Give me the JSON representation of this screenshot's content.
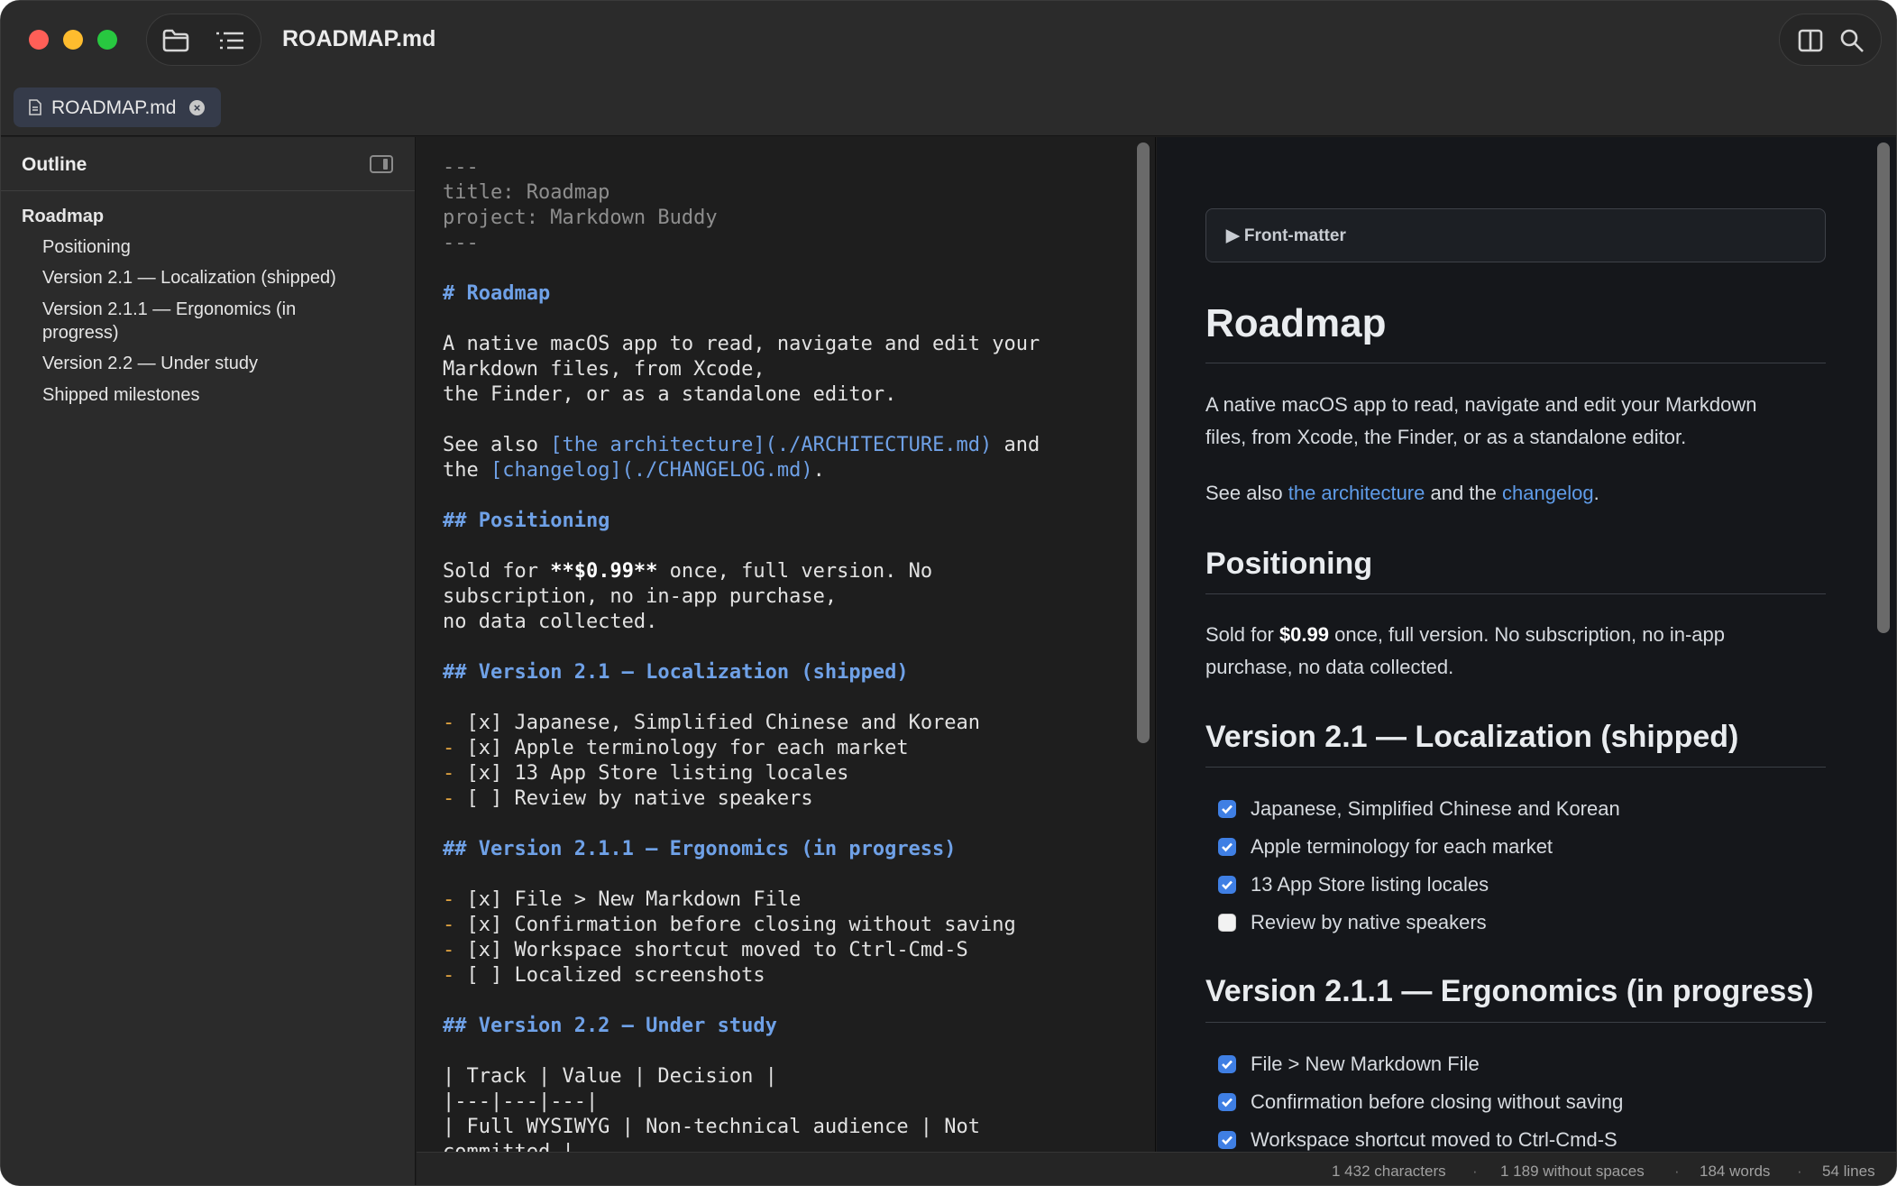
{
  "window": {
    "title": "ROADMAP.md"
  },
  "tab": {
    "label": "ROADMAP.md",
    "close": "×"
  },
  "sidebar": {
    "title": "Outline",
    "items": [
      {
        "label": "Roadmap"
      },
      {
        "label": "Positioning"
      },
      {
        "label": "Version 2.1 — Localization (shipped)"
      },
      {
        "label": "Version 2.1.1 — Ergonomics (in"
      },
      {
        "label": "progress)"
      },
      {
        "label": "Version 2.2 — Under study"
      },
      {
        "label": "Shipped milestones"
      }
    ]
  },
  "editor": {
    "fm_open": "---",
    "fm_title": "title: Roadmap",
    "fm_project": "project: Markdown Buddy",
    "fm_close": "---",
    "h1": "# Roadmap",
    "intro_1": "A native macOS app to read, navigate and edit your",
    "intro_2": "Markdown files, from Xcode,",
    "intro_3": "the Finder, or as a standalone editor.",
    "see_prefix": "See also ",
    "see_link_1": "[the architecture](./ARCHITECTURE.md)",
    "see_mid": " and",
    "see_the": "the ",
    "see_link_2": "[changelog](./CHANGELOG.md)",
    "see_end": ".",
    "h_positioning": "## Positioning",
    "pos_1_a": "Sold for ",
    "pos_1_b": "**$0.99**",
    "pos_1_c": " once, full version. No",
    "pos_2": "subscription, no in-app purchase,",
    "pos_3": "no data collected.",
    "h_v21": "## Version 2.1 — Localization (shipped)",
    "v21_items": [
      "[x] Japanese, Simplified Chinese and Korean",
      "[x] Apple terminology for each market",
      "[x] 13 App Store listing locales",
      "[ ] Review by native speakers"
    ],
    "h_v211": "## Version 2.1.1 — Ergonomics (in progress)",
    "v211_items": [
      "[x] File > New Markdown File",
      "[x] Confirmation before closing without saving",
      "[x] Workspace shortcut moved to Ctrl-Cmd-S",
      "[ ] Localized screenshots"
    ],
    "bullet": "- ",
    "h_v22": "## Version 2.2 — Under study",
    "table_1": "| Track | Value | Decision |",
    "table_2": "|---|---|---|",
    "table_3": "| Full WYSIWYG | Non-technical audience | Not",
    "table_4": "committed |"
  },
  "preview": {
    "front_matter": "▶ Front-matter",
    "h1": "Roadmap",
    "intro_1": "A native macOS app to read, navigate and edit your Markdown",
    "intro_2": "files, from Xcode, the Finder, or as a standalone editor.",
    "see_prefix": "See also ",
    "see_link_1": "the architecture",
    "see_mid": " and the ",
    "see_link_2": "changelog",
    "see_end": ".",
    "h_positioning": "Positioning",
    "pos_a": "Sold for ",
    "pos_b": "$0.99",
    "pos_c": " once, full version. No subscription, no in-app",
    "pos_2": "purchase, no data collected.",
    "h_v21": "Version 2.1 — Localization (shipped)",
    "v21_tasks": [
      {
        "label": "Japanese, Simplified Chinese and Korean",
        "checked": true
      },
      {
        "label": "Apple terminology for each market",
        "checked": true
      },
      {
        "label": "13 App Store listing locales",
        "checked": true
      },
      {
        "label": "Review by native speakers",
        "checked": false
      }
    ],
    "h_v211": "Version 2.1.1 — Ergonomics (in progress)",
    "v211_tasks": [
      {
        "label": "File > New Markdown File",
        "checked": true
      },
      {
        "label": "Confirmation before closing without saving",
        "checked": true
      },
      {
        "label": "Workspace shortcut moved to Ctrl-Cmd-S",
        "checked": true
      }
    ]
  },
  "status": {
    "characters": "1 432 characters",
    "without_spaces": "1 189 without spaces",
    "words": "184 words",
    "lines": "54 lines",
    "separator": "·"
  },
  "icons": {
    "folder": "folder-icon",
    "outline": "list-icon",
    "split": "split-view-icon",
    "search": "search-icon",
    "file": "document-icon"
  },
  "colors": {
    "accent": "#3f7fe4",
    "link": "#6fa1e7",
    "bullet": "#e0a340",
    "close": "#ff5f57",
    "minimize": "#febc2e",
    "maximize": "#28c840"
  }
}
